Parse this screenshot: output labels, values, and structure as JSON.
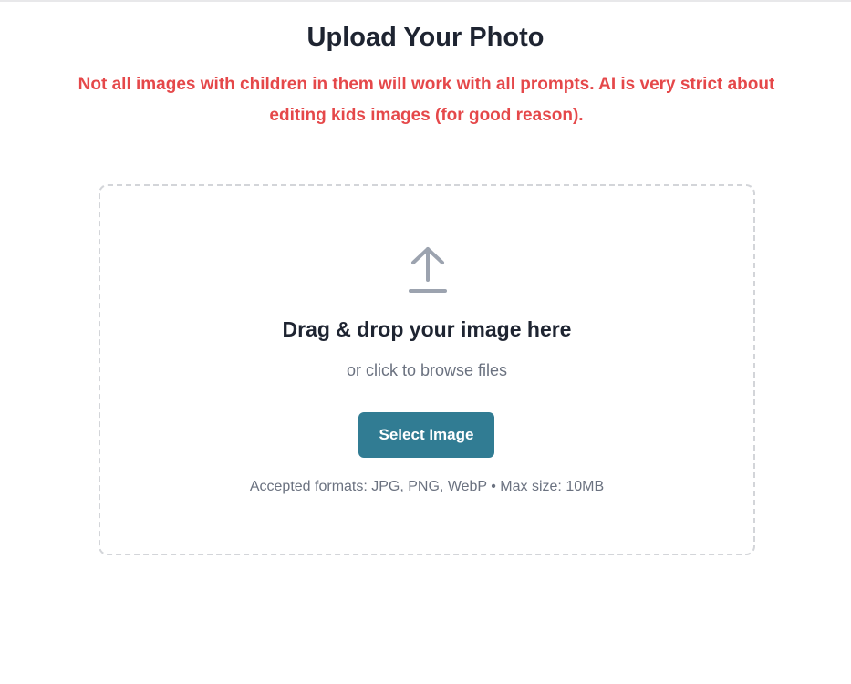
{
  "page": {
    "title": "Upload Your Photo",
    "warning": "Not all images with children in them will work with all prompts. AI is very strict about editing kids images (for good reason)."
  },
  "dropzone": {
    "icon": "upload-arrow-icon",
    "title": "Drag & drop your image here",
    "subtitle": "or click to browse files",
    "button_label": "Select Image",
    "formats_note": "Accepted formats: JPG, PNG, WebP • Max size: 10MB"
  },
  "colors": {
    "heading": "#1e2431",
    "warning": "#e5484a",
    "muted": "#6b7280",
    "button": "#317c93",
    "dropzone_border": "#d3d5d9",
    "icon": "#9ca3af"
  }
}
